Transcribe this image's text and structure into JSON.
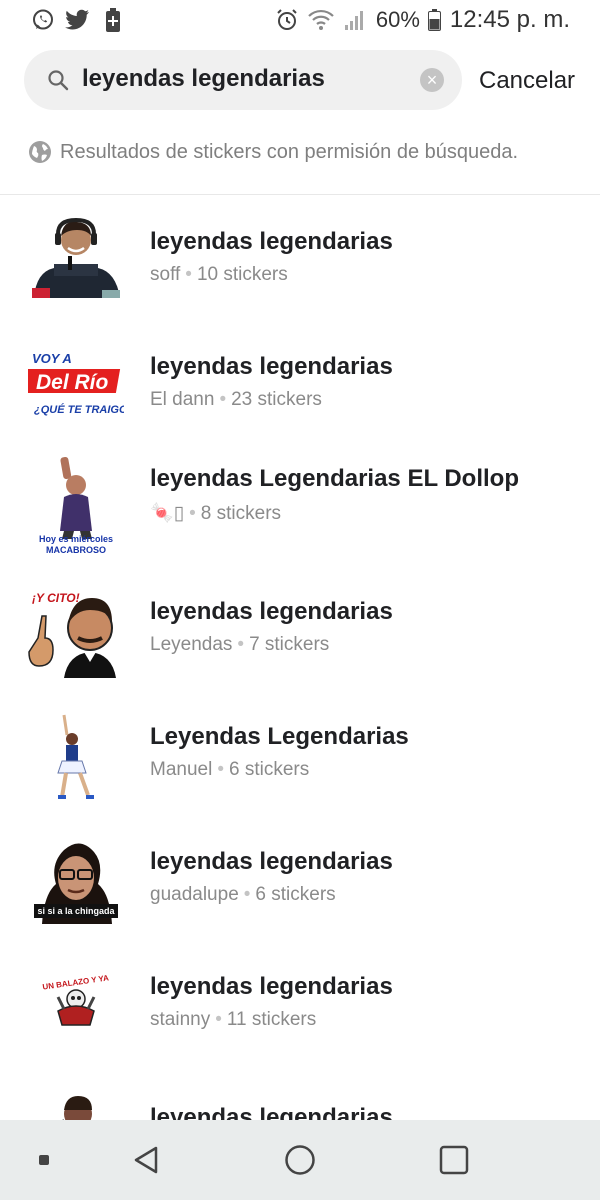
{
  "status_bar": {
    "battery_percent": "60%",
    "time": "12:45 p. m.",
    "icons_left": [
      "whatsapp-icon",
      "twitter-icon",
      "battery-plus-icon"
    ],
    "icons_right": [
      "alarm-icon",
      "wifi-icon",
      "signal-icon",
      "battery-icon"
    ]
  },
  "search": {
    "query": "leyendas legendarias",
    "cancel_label": "Cancelar"
  },
  "notice": {
    "text": "Resultados de stickers con permisión de búsqueda."
  },
  "results": [
    {
      "title": "leyendas legendarias",
      "author": "soff",
      "count": "10 stickers"
    },
    {
      "title": "leyendas legendarias",
      "author": "El dann",
      "count": "23 stickers"
    },
    {
      "title": "leyendas Legendarias EL Dollop",
      "author": "🍬▯",
      "count": "8 stickers"
    },
    {
      "title": "leyendas legendarias",
      "author": "Leyendas",
      "count": "7 stickers"
    },
    {
      "title": "Leyendas Legendarias",
      "author": "Manuel",
      "count": "6 stickers"
    },
    {
      "title": "leyendas legendarias",
      "author": "guadalupe",
      "count": "6 stickers"
    },
    {
      "title": "leyendas legendarias",
      "author": "stainny",
      "count": "11 stickers"
    },
    {
      "title": "leyendas legendarias",
      "author": "",
      "count": ""
    }
  ],
  "sticker_texts": {
    "s2_top": "VOY A",
    "s2_mid": "Del Río",
    "s2_bottom": "¿QUÉ TE TRAIGO?",
    "s3_caption1": "Hoy es miércoles",
    "s3_caption2": "MACABROSO",
    "s4_text": "¡Y CITO!",
    "s6_caption": "si si a la chingada",
    "s7_text": "UN BALAZO Y YA"
  },
  "nav_bar": {
    "icons": [
      "recents-dot-icon",
      "back-icon",
      "home-icon",
      "overview-icon"
    ]
  }
}
